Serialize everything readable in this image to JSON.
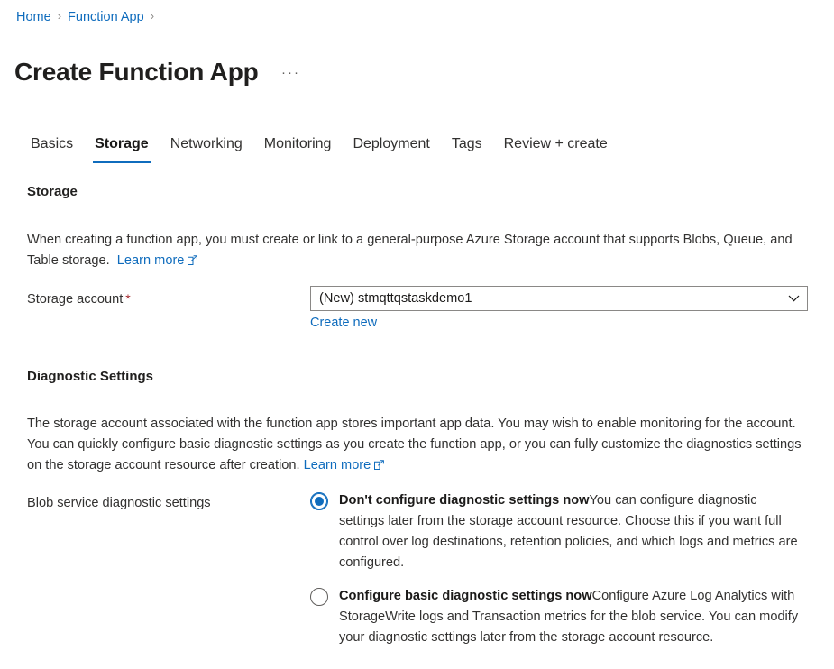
{
  "breadcrumb": {
    "items": [
      {
        "label": "Home"
      },
      {
        "label": "Function App"
      }
    ],
    "separator": "›"
  },
  "header": {
    "title": "Create Function App",
    "more_label": "···"
  },
  "tabs": [
    {
      "label": "Basics",
      "active": false
    },
    {
      "label": "Storage",
      "active": true
    },
    {
      "label": "Networking",
      "active": false
    },
    {
      "label": "Monitoring",
      "active": false
    },
    {
      "label": "Deployment",
      "active": false
    },
    {
      "label": "Tags",
      "active": false
    },
    {
      "label": "Review + create",
      "active": false
    }
  ],
  "storage_section": {
    "heading": "Storage",
    "description": "When creating a function app, you must create or link to a general-purpose Azure Storage account that supports Blobs, Queue, and Table storage.",
    "learn_more": "Learn more",
    "storage_account": {
      "label": "Storage account",
      "required_marker": "*",
      "value": "(New) stmqttqstaskdemo1",
      "create_new_link": "Create new"
    }
  },
  "diagnostic_section": {
    "heading": "Diagnostic Settings",
    "description": "The storage account associated with the function app stores important app data. You may wish to enable monitoring for the account. You can quickly configure basic diagnostic settings as you create the function app, or you can fully customize the diagnostics settings on the storage account resource after creation.",
    "learn_more": "Learn more",
    "blob_setting": {
      "label": "Blob service diagnostic settings",
      "options": [
        {
          "title": "Don't configure diagnostic settings now",
          "description": "You can configure diagnostic settings later from the storage account resource. Choose this if you want full control over log destinations, retention policies, and which logs and metrics are configured.",
          "selected": true
        },
        {
          "title": "Configure basic diagnostic settings now",
          "description": "Configure Azure Log Analytics with StorageWrite logs and Transaction metrics for the blob service. You can modify your diagnostic settings later from the storage account resource.",
          "selected": false
        }
      ]
    }
  },
  "colors": {
    "link": "#0f6cbd",
    "accent": "#0f6cbd",
    "required": "#a4262c",
    "text": "#323130",
    "border": "#8a8886"
  }
}
